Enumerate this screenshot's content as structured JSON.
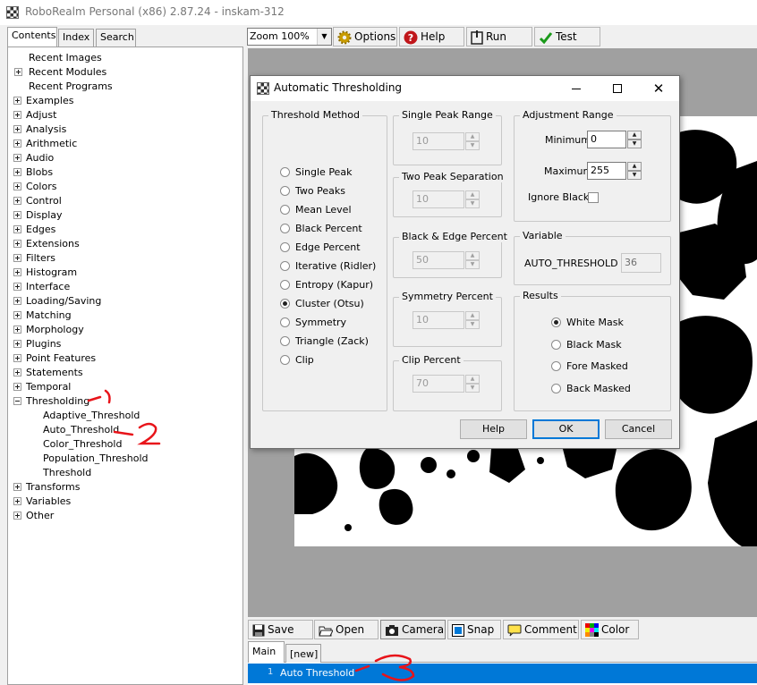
{
  "window": {
    "title": "RoboRealm Personal (x86) 2.87.24 - inskam-312"
  },
  "left_panel": {
    "tabs": [
      "Contents",
      "Index",
      "Search"
    ],
    "tree": [
      {
        "label": "Recent Images",
        "level": 1,
        "toggle": "none"
      },
      {
        "label": "Recent Modules",
        "level": 1,
        "toggle": "plus"
      },
      {
        "label": "Recent Programs",
        "level": 1,
        "toggle": "none"
      },
      {
        "label": "Examples",
        "level": 0,
        "toggle": "plus"
      },
      {
        "label": "Adjust",
        "level": 0,
        "toggle": "plus"
      },
      {
        "label": "Analysis",
        "level": 0,
        "toggle": "plus"
      },
      {
        "label": "Arithmetic",
        "level": 0,
        "toggle": "plus"
      },
      {
        "label": "Audio",
        "level": 0,
        "toggle": "plus"
      },
      {
        "label": "Blobs",
        "level": 0,
        "toggle": "plus"
      },
      {
        "label": "Colors",
        "level": 0,
        "toggle": "plus"
      },
      {
        "label": "Control",
        "level": 0,
        "toggle": "plus"
      },
      {
        "label": "Display",
        "level": 0,
        "toggle": "plus"
      },
      {
        "label": "Edges",
        "level": 0,
        "toggle": "plus"
      },
      {
        "label": "Extensions",
        "level": 0,
        "toggle": "plus"
      },
      {
        "label": "Filters",
        "level": 0,
        "toggle": "plus"
      },
      {
        "label": "Histogram",
        "level": 0,
        "toggle": "plus"
      },
      {
        "label": "Interface",
        "level": 0,
        "toggle": "plus"
      },
      {
        "label": "Loading/Saving",
        "level": 0,
        "toggle": "plus"
      },
      {
        "label": "Matching",
        "level": 0,
        "toggle": "plus"
      },
      {
        "label": "Morphology",
        "level": 0,
        "toggle": "plus"
      },
      {
        "label": "Plugins",
        "level": 0,
        "toggle": "plus"
      },
      {
        "label": "Point Features",
        "level": 0,
        "toggle": "plus"
      },
      {
        "label": "Statements",
        "level": 0,
        "toggle": "plus"
      },
      {
        "label": "Temporal",
        "level": 0,
        "toggle": "plus"
      },
      {
        "label": "Thresholding",
        "level": 0,
        "toggle": "minus"
      },
      {
        "label": "Adaptive_Threshold",
        "level": 2,
        "toggle": "none"
      },
      {
        "label": "Auto_Threshold",
        "level": 2,
        "toggle": "none"
      },
      {
        "label": "Color_Threshold",
        "level": 2,
        "toggle": "none"
      },
      {
        "label": "Population_Threshold",
        "level": 2,
        "toggle": "none"
      },
      {
        "label": "Threshold",
        "level": 2,
        "toggle": "none"
      },
      {
        "label": "Transforms",
        "level": 0,
        "toggle": "plus"
      },
      {
        "label": "Variables",
        "level": 0,
        "toggle": "plus"
      },
      {
        "label": "Other",
        "level": 0,
        "toggle": "plus"
      }
    ]
  },
  "toolbar": {
    "zoom_value": "Zoom 100%",
    "options_label": "Options",
    "help_label": "Help",
    "run_label": "Run",
    "test_label": "Test"
  },
  "dialog": {
    "title": "Automatic Thresholding",
    "threshold_method": {
      "legend": "Threshold Method",
      "options": [
        "Single Peak",
        "Two Peaks",
        "Mean Level",
        "Black Percent",
        "Edge Percent",
        "Iterative (Ridler)",
        "Entropy (Kapur)",
        "Cluster (Otsu)",
        "Symmetry",
        "Triangle (Zack)",
        "Clip"
      ],
      "selected": "Cluster (Otsu)"
    },
    "single_peak_range": {
      "legend": "Single Peak Range",
      "value": "10"
    },
    "two_peak_separation": {
      "legend": "Two Peak Separation",
      "value": "10"
    },
    "black_edge_percent": {
      "legend": "Black & Edge Percent",
      "value": "50"
    },
    "symmetry_percent": {
      "legend": "Symmetry Percent",
      "value": "10"
    },
    "clip_percent": {
      "legend": "Clip Percent",
      "value": "70"
    },
    "adjustment_range": {
      "legend": "Adjustment Range",
      "minimum_label": "Minimum",
      "minimum_value": "0",
      "maximum_label": "Maximum",
      "maximum_value": "255",
      "ignore_black_label": "Ignore Black"
    },
    "variable": {
      "legend": "Variable",
      "name": "AUTO_THRESHOLD",
      "value": "36"
    },
    "results": {
      "legend": "Results",
      "options": [
        "White Mask",
        "Black Mask",
        "Fore Masked",
        "Back Masked"
      ],
      "selected": "White Mask"
    },
    "buttons": {
      "help": "Help",
      "ok": "OK",
      "cancel": "Cancel"
    }
  },
  "bottom_toolbar": {
    "save": "Save",
    "open": "Open",
    "camera": "Camera",
    "snap": "Snap",
    "comment": "Comment",
    "color": "Color"
  },
  "pipeline_tabs": [
    "Main",
    "[new]"
  ],
  "pipeline": [
    {
      "index": "1",
      "label": "Auto Threshold"
    }
  ],
  "annotations": [
    "1",
    "2",
    "3"
  ],
  "colors": {
    "selection": "#0078d7",
    "annotation": "#e8141a"
  }
}
